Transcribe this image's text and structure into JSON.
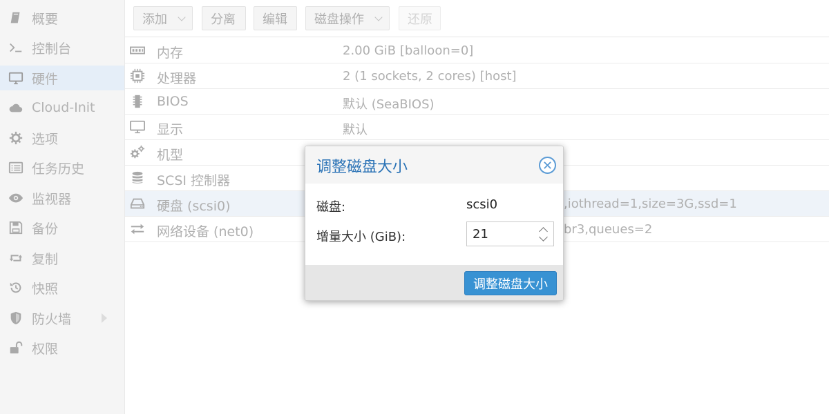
{
  "sidebar": {
    "items": [
      {
        "label": "概要",
        "icon": "book-icon"
      },
      {
        "label": "控制台",
        "icon": "terminal-icon"
      },
      {
        "label": "硬件",
        "icon": "monitor-icon",
        "active": true
      },
      {
        "label": "Cloud-Init",
        "icon": "cloud-icon"
      },
      {
        "label": "选项",
        "icon": "gear-icon"
      },
      {
        "label": "任务历史",
        "icon": "list-icon"
      },
      {
        "label": "监视器",
        "icon": "eye-icon"
      },
      {
        "label": "备份",
        "icon": "floppy-icon"
      },
      {
        "label": "复制",
        "icon": "retweet-icon"
      },
      {
        "label": "快照",
        "icon": "history-icon"
      },
      {
        "label": "防火墙",
        "icon": "shield-icon"
      },
      {
        "label": "权限",
        "icon": "unlock-icon"
      }
    ]
  },
  "toolbar": {
    "add_label": "添加",
    "detach_label": "分离",
    "edit_label": "编辑",
    "disk_action_label": "磁盘操作",
    "revert_label": "还原"
  },
  "hardware": {
    "rows": [
      {
        "name": "内存",
        "value": "2.00 GiB [balloon=0]",
        "icon": "memory-icon"
      },
      {
        "name": "处理器",
        "value": "2 (1 sockets, 2 cores) [host]",
        "icon": "cpu-icon"
      },
      {
        "name": "BIOS",
        "value": "默认 (SeaBIOS)",
        "icon": "chip-icon"
      },
      {
        "name": "显示",
        "value": "默认",
        "icon": "desktop-icon"
      },
      {
        "name": "机型",
        "value": "",
        "icon": "cogs-icon"
      },
      {
        "name": "SCSI 控制器",
        "value": "",
        "icon": "database-icon"
      },
      {
        "name": "硬盘 (scsi0)",
        "value": ",iothread=1,size=3G,ssd=1",
        "icon": "hdd-icon"
      },
      {
        "name": "网络设备 (net0)",
        "value": "br3,queues=2",
        "icon": "exchange-icon"
      }
    ]
  },
  "dialog": {
    "title": "调整磁盘大小",
    "disk_label": "磁盘:",
    "disk_value": "scsi0",
    "increment_label": "增量大小 (GiB):",
    "increment_value": "21",
    "submit_label": "调整磁盘大小"
  },
  "colors": {
    "accent": "#3892d3",
    "title": "#2b73b6",
    "sidebar_active": "#e5eef8"
  }
}
